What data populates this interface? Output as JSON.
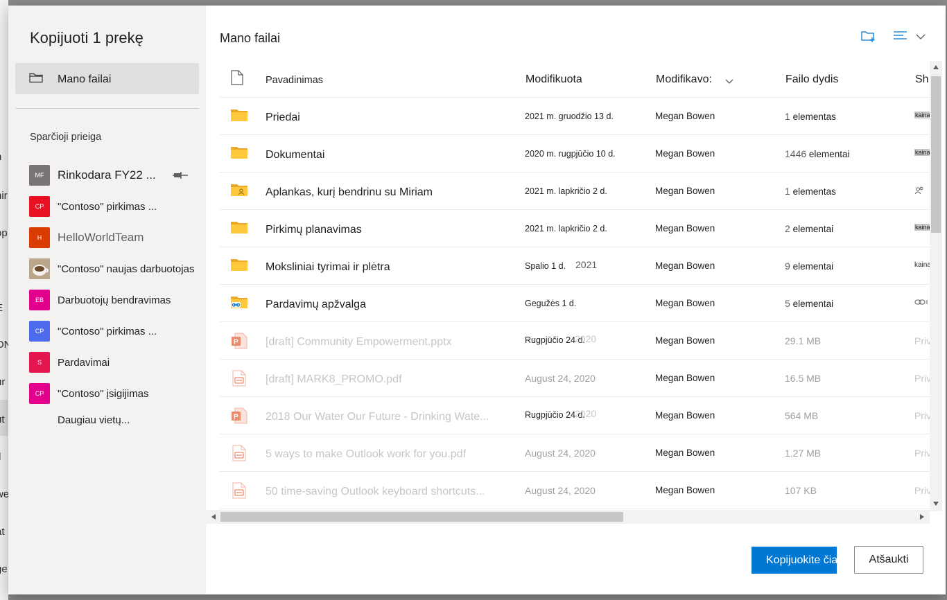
{
  "background_fragments": [
    "h",
    "nir",
    "op",
    "E",
    "ON",
    "ur",
    "ut",
    "tl",
    "we",
    "at",
    "ge"
  ],
  "dialog": {
    "title": "Kopijuoti 1 prekę",
    "nav_my_files": "Mano failai",
    "quick_access_title": "Sparčioji prieiga",
    "quick_access": [
      {
        "initials": "MF",
        "label": "Rinkodara FY22 ...",
        "color": "#7a7574",
        "pinned": true,
        "icon": "pin-icon"
      },
      {
        "initials": "CP",
        "label": "\"Contoso\" pirkimas ...",
        "color": "#e81123"
      },
      {
        "initials": "H",
        "label": "HelloWorldTeam",
        "color": "#da3b01"
      },
      {
        "initials": "",
        "label": "\"Contoso\" naujas darbuotojas",
        "color": "#c9b59a",
        "icon": "coffee-cup-photo"
      },
      {
        "initials": "EB",
        "label": "Darbuotojų bendravimas",
        "color": "#e3008c"
      },
      {
        "initials": "CP",
        "label": "\"Contoso\" pirkimas ...",
        "color": "#4f6bed"
      },
      {
        "initials": "S",
        "label": "Pardavimai",
        "color": "#e3164f"
      },
      {
        "initials": "CP",
        "label": "\"Contoso\" įsigijimas",
        "color": "#e3008c"
      }
    ],
    "more_places": "Daugiau vietų...",
    "breadcrumb": "Mano failai",
    "columns": {
      "name": "Pavadinimas",
      "modified": "Modifikuota",
      "modified_by": "Modifikavo:",
      "size": "Failo dydis",
      "sharing": "Sh"
    },
    "rows": [
      {
        "icon": "folder-icon",
        "name": "Priedai",
        "modified": "2021 m. gruodžio 13 d.",
        "by": "Megan Bowen",
        "size_num": "1",
        "size_unit": "elementas",
        "share": "kaina",
        "disabled": false
      },
      {
        "icon": "folder-icon",
        "name": "Dokumentai",
        "modified": "2020 m. rugpjūčio 10 d.",
        "by": "Megan Bowen",
        "size_num": "1446",
        "size_unit": "elementai",
        "share": "kaina",
        "disabled": false
      },
      {
        "icon": "shared-folder-icon",
        "name": "Aplankas, kurį bendrinu su Miriam",
        "modified": "2021 m. lapkričio 2 d.",
        "by": "Megan Bowen",
        "size_num": "1",
        "size_unit": "elementas",
        "share": "people-icon",
        "disabled": false
      },
      {
        "icon": "folder-icon",
        "name": "Pirkimų planavimas",
        "modified": "2021 m. lapkričio 2 d.",
        "by": "Megan Bowen",
        "size_num": "2",
        "size_unit": "elementai",
        "share": "kaina",
        "disabled": false
      },
      {
        "icon": "folder-icon",
        "name": "Moksliniai tyrimai ir plėtra",
        "modified": "Spalio 1 d.",
        "modified_extra": "2021",
        "by": "Megan Bowen",
        "size_num": "9",
        "size_unit": "elementai",
        "share": "kaina",
        "disabled": false
      },
      {
        "icon": "link-folder-icon",
        "name": "Pardavimų apžvalga",
        "modified": "Gegužės 1 d.",
        "by": "Megan Bowen",
        "size_num": "5",
        "size_unit": "elementai",
        "share": "link-icon",
        "disabled": false
      },
      {
        "icon": "pptx-icon",
        "name": "[draft] Community Empowerment.pptx",
        "modified": "Rugpjūčio 24 d.",
        "modified_extra": "2020",
        "by": "Megan Bowen",
        "size": "29.1 MB",
        "share": "Priv",
        "disabled": true
      },
      {
        "icon": "pdf-icon",
        "name": "[draft] MARK8_PROMO.pdf",
        "modified": "August 24, 2020",
        "by": "Megan Bowen",
        "size": "16.5 MB",
        "share": "Priv",
        "disabled": true
      },
      {
        "icon": "pptx-icon",
        "name": "2018 Our Water Our Future - Drinking Wate...",
        "modified": "Rugpjūčio 24 d.",
        "modified_extra": "2020",
        "by": "Megan Bowen",
        "size": "564 MB",
        "share": "Priv",
        "disabled": true
      },
      {
        "icon": "pdf-icon",
        "name": "5 ways to make Outlook work for you.pdf",
        "modified": "August 24, 2020",
        "by": "Megan Bowen",
        "size": "1.27 MB",
        "share": "Priv",
        "disabled": true
      },
      {
        "icon": "pdf-icon",
        "name": "50 time-saving Outlook keyboard shortcuts...",
        "modified": "August 24, 2020",
        "by": "Megan Bowen",
        "size": "107 KB",
        "share": "Priv",
        "disabled": true
      }
    ],
    "primary_button": "Kopijuokite čia",
    "secondary_button": "Atšaukti",
    "accent_color": "#0078d4",
    "folder_color": "#ffc83d"
  }
}
